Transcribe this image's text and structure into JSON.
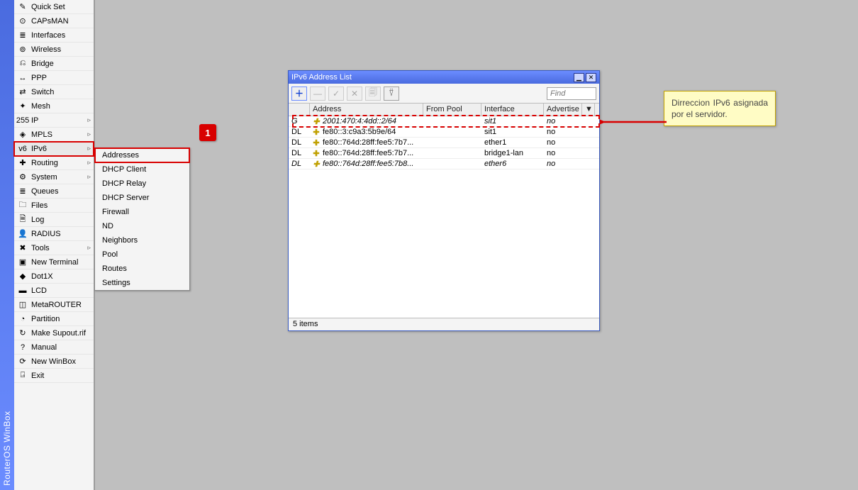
{
  "app_title": "RouterOS WinBox",
  "sidebar": {
    "items": [
      {
        "label": "Quick Set",
        "icon": "✎",
        "submenu": false
      },
      {
        "label": "CAPsMAN",
        "icon": "⊙",
        "submenu": false
      },
      {
        "label": "Interfaces",
        "icon": "≣",
        "submenu": false
      },
      {
        "label": "Wireless",
        "icon": "⊚",
        "submenu": false
      },
      {
        "label": "Bridge",
        "icon": "⎌",
        "submenu": false
      },
      {
        "label": "PPP",
        "icon": "↔",
        "submenu": false
      },
      {
        "label": "Switch",
        "icon": "⇄",
        "submenu": false
      },
      {
        "label": "Mesh",
        "icon": "✦",
        "submenu": false
      },
      {
        "label": "IP",
        "icon": "255",
        "submenu": true
      },
      {
        "label": "MPLS",
        "icon": "◈",
        "submenu": true
      },
      {
        "label": "IPv6",
        "icon": "v6",
        "submenu": true,
        "selected": true
      },
      {
        "label": "Routing",
        "icon": "✚",
        "submenu": true
      },
      {
        "label": "System",
        "icon": "⚙",
        "submenu": true
      },
      {
        "label": "Queues",
        "icon": "≣",
        "submenu": false
      },
      {
        "label": "Files",
        "icon": "🗀",
        "submenu": false
      },
      {
        "label": "Log",
        "icon": "🗎",
        "submenu": false
      },
      {
        "label": "RADIUS",
        "icon": "👤",
        "submenu": false
      },
      {
        "label": "Tools",
        "icon": "✖",
        "submenu": true
      },
      {
        "label": "New Terminal",
        "icon": "▣",
        "submenu": false
      },
      {
        "label": "Dot1X",
        "icon": "◆",
        "submenu": false
      },
      {
        "label": "LCD",
        "icon": "▬",
        "submenu": false
      },
      {
        "label": "MetaROUTER",
        "icon": "◫",
        "submenu": false
      },
      {
        "label": "Partition",
        "icon": "◔",
        "submenu": false
      },
      {
        "label": "Make Supout.rif",
        "icon": "↻",
        "submenu": false
      },
      {
        "label": "Manual",
        "icon": "?",
        "submenu": false
      },
      {
        "label": "New WinBox",
        "icon": "⟳",
        "submenu": false
      },
      {
        "label": "Exit",
        "icon": "⍈",
        "submenu": false
      }
    ]
  },
  "submenu": {
    "items": [
      {
        "label": "Addresses",
        "selected": true
      },
      {
        "label": "DHCP Client"
      },
      {
        "label": "DHCP Relay"
      },
      {
        "label": "DHCP Server"
      },
      {
        "label": "Firewall"
      },
      {
        "label": "ND"
      },
      {
        "label": "Neighbors"
      },
      {
        "label": "Pool"
      },
      {
        "label": "Routes"
      },
      {
        "label": "Settings"
      }
    ]
  },
  "window": {
    "title": "IPv6 Address List",
    "find_placeholder": "Find",
    "columns": {
      "flag": "",
      "address": "Address",
      "from_pool": "From Pool",
      "interface": "Interface",
      "advertise": "Advertise"
    },
    "rows": [
      {
        "flag": "G",
        "address": "2001:470:4:4dd::2/64",
        "from_pool": "",
        "interface": "sit1",
        "advertise": "no",
        "italic": true
      },
      {
        "flag": "DL",
        "address": "fe80::3:c9a3:5b9e/64",
        "from_pool": "",
        "interface": "sit1",
        "advertise": "no",
        "italic": false
      },
      {
        "flag": "DL",
        "address": "fe80::764d:28ff:fee5:7b7...",
        "from_pool": "",
        "interface": "ether1",
        "advertise": "no",
        "italic": false
      },
      {
        "flag": "DL",
        "address": "fe80::764d:28ff:fee5:7b7...",
        "from_pool": "",
        "interface": "bridge1-lan",
        "advertise": "no",
        "italic": false
      },
      {
        "flag": "DL",
        "address": "fe80::764d:28ff:fee5:7b8...",
        "from_pool": "",
        "interface": "ether6",
        "advertise": "no",
        "italic": true
      }
    ],
    "status": "5 items"
  },
  "badge": {
    "label": "1"
  },
  "callout": {
    "text": "Dirreccion IPv6 asignada por el servidor."
  },
  "toolbar_glyphs": {
    "add": "＋",
    "remove": "—",
    "enable": "✓",
    "disable": "✕",
    "comment": "🗐",
    "filter": "⍢",
    "dropdown": "▼"
  }
}
